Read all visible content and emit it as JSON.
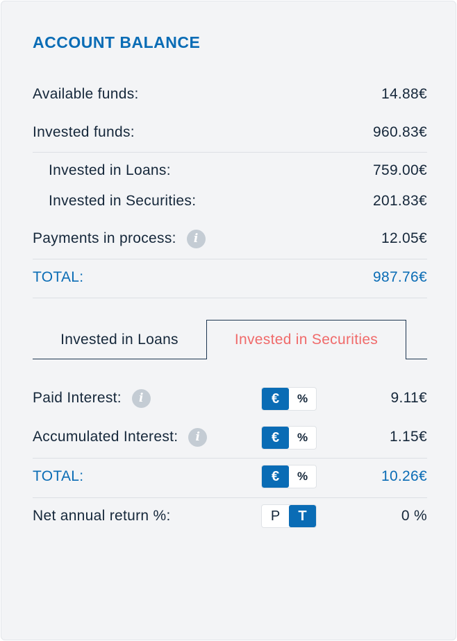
{
  "title": "ACCOUNT BALANCE",
  "balance": {
    "available_label": "Available funds:",
    "available_value": "14.88€",
    "invested_label": "Invested funds:",
    "invested_value": "960.83€",
    "loans_label": "Invested in Loans:",
    "loans_value": "759.00€",
    "securities_label": "Invested in Securities:",
    "securities_value": "201.83€",
    "payments_label": "Payments in process:",
    "payments_value": "12.05€",
    "total_label": "TOTAL:",
    "total_value": "987.76€"
  },
  "tabs": {
    "loans": "Invested in Loans",
    "securities": "Invested in Securities",
    "active": "securities"
  },
  "stats": {
    "paid_label": "Paid Interest:",
    "paid_value": "9.11€",
    "accumulated_label": "Accumulated Interest:",
    "accumulated_value": "1.15€",
    "total_label": "TOTAL:",
    "total_value": "10.26€",
    "net_label": "Net annual return %:",
    "net_value": "0 %"
  },
  "toggles": {
    "euro": "€",
    "percent": "%",
    "p": "P",
    "t": "T"
  },
  "icons": {
    "info": "i"
  },
  "colors": {
    "accent": "#0a6cb5",
    "active_tab_text": "#f06a6a",
    "text": "#15273a",
    "background": "#f3f4f6"
  }
}
